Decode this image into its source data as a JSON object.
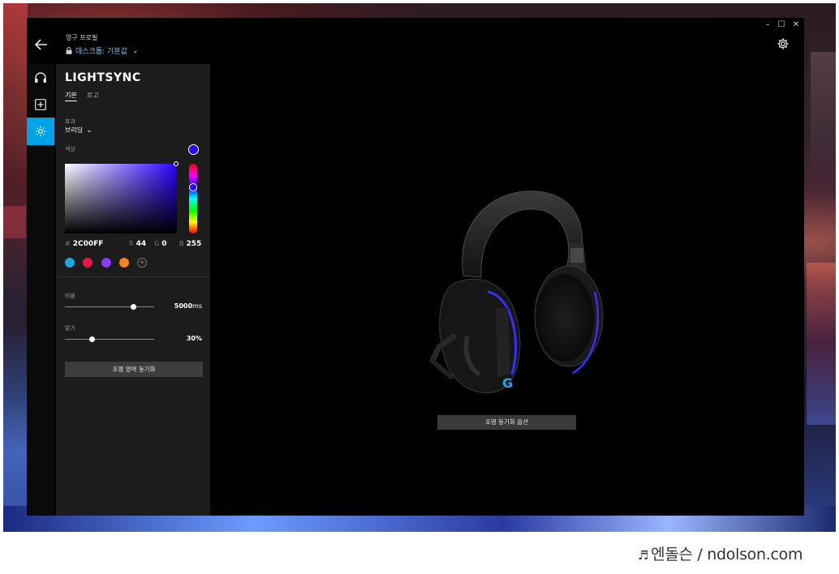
{
  "window": {
    "profile_label": "영구 프로필",
    "profile_name": "데스크톱: 기본값",
    "controls": [
      "–",
      "☐",
      "✕"
    ]
  },
  "rail": {
    "items": [
      {
        "name": "headset-icon",
        "active": false
      },
      {
        "name": "add-assignment-icon",
        "active": false
      },
      {
        "name": "lighting-icon",
        "active": true
      }
    ],
    "accent_color": "#00a3e8"
  },
  "panel": {
    "title": "LIGHTSYNC",
    "tabs": [
      {
        "label": "기본",
        "active": true
      },
      {
        "label": "로고",
        "active": false
      }
    ],
    "effect_label": "효과",
    "effect_value": "브리딩",
    "color_label": "색상",
    "current_color": "#2c00ff",
    "hex_prefix": "#",
    "hex_value": "2C00FF",
    "r_label": "R",
    "r_value": "44",
    "g_label": "G",
    "g_value": "0",
    "b_label": "B",
    "b_value": "255",
    "presets": [
      "#1fa5e0",
      "#e8194a",
      "#8a3cf0",
      "#f5821f"
    ],
    "add_preset": "+",
    "rate_label": "비율",
    "rate_value": "5000",
    "rate_unit": "ms",
    "rate_fraction": 0.77,
    "brightness_label": "밝기",
    "brightness_value": "30",
    "brightness_unit": "%",
    "brightness_fraction": 0.3,
    "sync_zone_button": "조명 영역 동기화"
  },
  "main": {
    "sync_options_button": "조명 동기화 옵션"
  },
  "watermark": {
    "note": "♬",
    "text": "엔돌슨 / ndolson.com"
  }
}
